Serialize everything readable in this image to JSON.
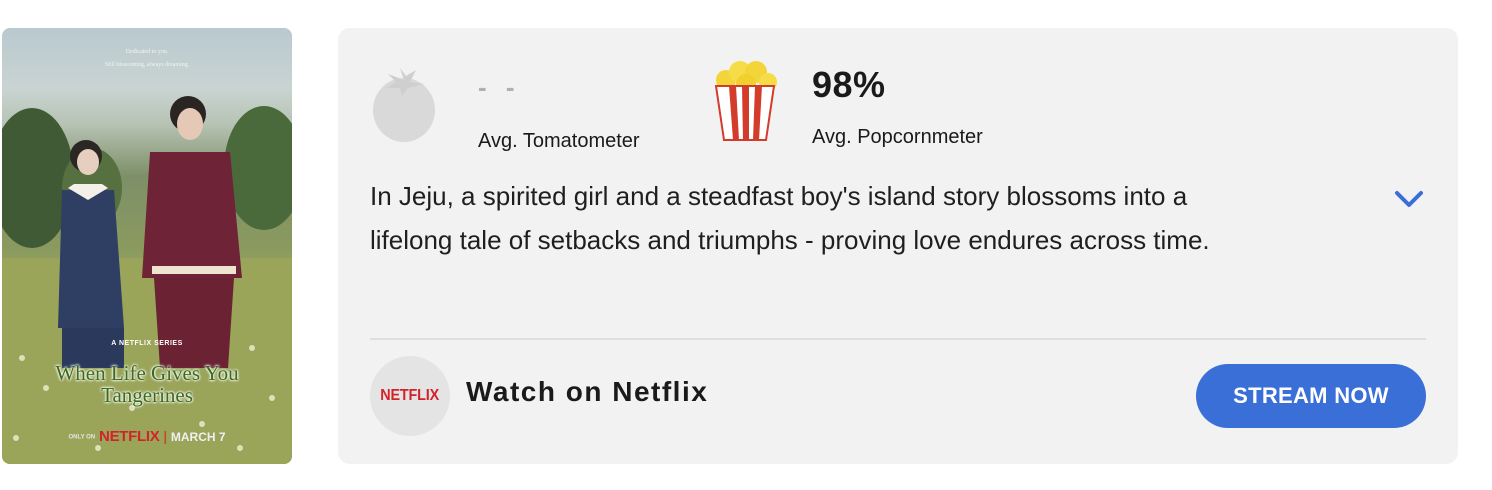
{
  "poster": {
    "tagline": [
      "Dedicated to you.",
      "Still blossoming, always dreaming."
    ],
    "series_label": "A NETFLIX SERIES",
    "title_line1": "When Life Gives You",
    "title_line2": "Tangerines",
    "only_on": "ONLY ON",
    "brand": "NETFLIX",
    "separator": "|",
    "date": "MARCH 7"
  },
  "scores": {
    "tomatometer": {
      "value": "- -",
      "label": "Avg. Tomatometer",
      "icon": "tomato-icon"
    },
    "popcornmeter": {
      "value": "98%",
      "label": "Avg. Popcornmeter",
      "icon": "popcorn-bucket-icon"
    }
  },
  "synopsis": {
    "line1": "In Jeju, a spirited girl and a steadfast boy's island story blossoms into a",
    "line2": "lifelong tale of setbacks and triumphs - proving love endures across time."
  },
  "provider": {
    "logo_text": "NETFLIX",
    "watch_label": "Watch on Netflix",
    "stream_button": "STREAM NOW"
  },
  "colors": {
    "card_background": "#f2f2f2",
    "stream_button": "#3a6fd8",
    "netflix_red": "#d3232a",
    "chevron": "#3a6fd8"
  }
}
